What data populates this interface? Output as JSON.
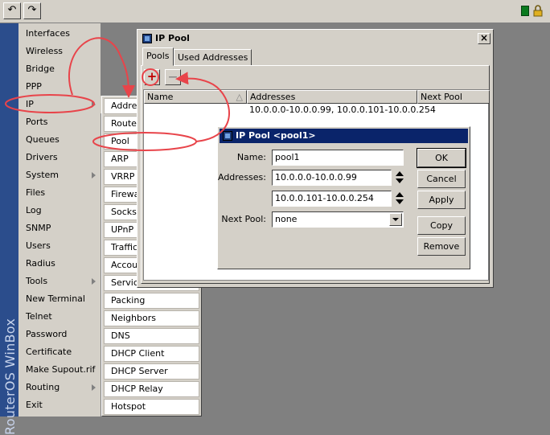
{
  "toolbar": {
    "undo_icon": "undo-icon",
    "redo_icon": "redo-icon"
  },
  "brand": {
    "band_text": "RouterOS WinBox"
  },
  "menu": {
    "items": [
      {
        "label": "Interfaces"
      },
      {
        "label": "Wireless"
      },
      {
        "label": "Bridge"
      },
      {
        "label": "PPP"
      },
      {
        "label": "IP",
        "submenu": true
      },
      {
        "label": "Ports"
      },
      {
        "label": "Queues"
      },
      {
        "label": "Drivers"
      },
      {
        "label": "System",
        "submenu": true
      },
      {
        "label": "Files"
      },
      {
        "label": "Log"
      },
      {
        "label": "SNMP"
      },
      {
        "label": "Users"
      },
      {
        "label": "Radius"
      },
      {
        "label": "Tools",
        "submenu": true
      },
      {
        "label": "New Terminal"
      },
      {
        "label": "Telnet"
      },
      {
        "label": "Password"
      },
      {
        "label": "Certificate"
      },
      {
        "label": "Make Supout.rif"
      },
      {
        "label": "Routing",
        "submenu": true
      },
      {
        "label": "Exit"
      }
    ]
  },
  "submenu": {
    "items": [
      {
        "label": "Addresses"
      },
      {
        "label": "Routes"
      },
      {
        "label": "Pool"
      },
      {
        "label": "ARP"
      },
      {
        "label": "VRRP"
      },
      {
        "label": "Firewall"
      },
      {
        "label": "Socks"
      },
      {
        "label": "UPnP"
      },
      {
        "label": "Traffic Flow"
      },
      {
        "label": "Accounting"
      },
      {
        "label": "Services"
      },
      {
        "label": "Packing"
      },
      {
        "label": "Neighbors"
      },
      {
        "label": "DNS"
      },
      {
        "label": "DHCP Client"
      },
      {
        "label": "DHCP Server"
      },
      {
        "label": "DHCP Relay"
      },
      {
        "label": "Hotspot"
      }
    ]
  },
  "pool_window": {
    "title": "IP Pool",
    "close": "×",
    "tabs": [
      "Pools",
      "Used Addresses"
    ],
    "add_button": "+",
    "remove_button": "—",
    "columns": [
      "Name",
      "Addresses",
      "Next Pool"
    ],
    "rows": [
      {
        "name": "",
        "addresses": "10.0.0.0-10.0.0.99, 10.0.0.101-10.0.0.254",
        "next_pool": ""
      }
    ]
  },
  "dialog": {
    "title": "IP Pool <pool1>",
    "name_label": "Name:",
    "name_value": "pool1",
    "addresses_label": "Addresses:",
    "address1": "10.0.0.0-10.0.0.99",
    "address2": "10.0.0.101-10.0.0.254",
    "next_pool_label": "Next Pool:",
    "next_pool_value": "none",
    "buttons": {
      "ok": "OK",
      "cancel": "Cancel",
      "apply": "Apply",
      "copy": "Copy",
      "remove": "Remove"
    }
  },
  "annotations": {
    "color": "#e8444a"
  }
}
